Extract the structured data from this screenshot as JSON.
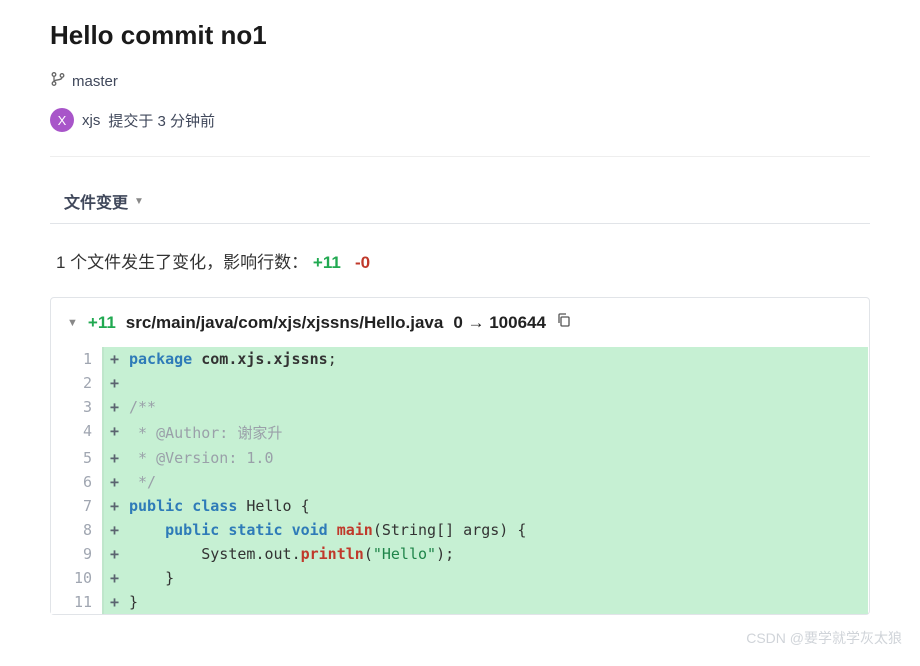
{
  "title": "Hello commit no1",
  "branch": {
    "name": "master"
  },
  "author": {
    "initial": "X",
    "name": "xjs",
    "meta": "提交于 3 分钟前"
  },
  "tabs": {
    "changes": "文件变更"
  },
  "summary": {
    "prefix": "1 个文件发生了变化，影响行数：",
    "add": "+11",
    "del": "-0"
  },
  "file": {
    "add_count": "+11",
    "path": "src/main/java/com/xjs/xjssns/Hello.java",
    "mode": "0 → 100644"
  },
  "lines": [
    {
      "n": "1",
      "tokens": [
        [
          "kw",
          "package"
        ],
        [
          "plain",
          " "
        ],
        [
          "pkg",
          "com.xjs.xjssns"
        ],
        [
          "plain",
          ";"
        ]
      ]
    },
    {
      "n": "2",
      "tokens": []
    },
    {
      "n": "3",
      "tokens": [
        [
          "cm",
          "/**"
        ]
      ]
    },
    {
      "n": "4",
      "tokens": [
        [
          "cm",
          " * @Author: 谢家升"
        ]
      ]
    },
    {
      "n": "5",
      "tokens": [
        [
          "cm",
          " * @Version: 1.0"
        ]
      ]
    },
    {
      "n": "6",
      "tokens": [
        [
          "cm",
          " */"
        ]
      ]
    },
    {
      "n": "7",
      "tokens": [
        [
          "kw",
          "public"
        ],
        [
          "plain",
          " "
        ],
        [
          "kw",
          "class"
        ],
        [
          "plain",
          " "
        ],
        [
          "cls",
          "Hello"
        ],
        [
          "plain",
          " {"
        ]
      ]
    },
    {
      "n": "8",
      "tokens": [
        [
          "plain",
          "    "
        ],
        [
          "kw",
          "public"
        ],
        [
          "plain",
          " "
        ],
        [
          "kw",
          "static"
        ],
        [
          "plain",
          " "
        ],
        [
          "kw",
          "void"
        ],
        [
          "plain",
          " "
        ],
        [
          "fn",
          "main"
        ],
        [
          "plain",
          "("
        ],
        [
          "type",
          "String"
        ],
        [
          "plain",
          "[] args) {"
        ]
      ]
    },
    {
      "n": "9",
      "tokens": [
        [
          "plain",
          "        "
        ],
        [
          "type",
          "System"
        ],
        [
          "plain",
          "."
        ],
        [
          "type",
          "out"
        ],
        [
          "plain",
          "."
        ],
        [
          "fn",
          "println"
        ],
        [
          "plain",
          "("
        ],
        [
          "str",
          "\"Hello\""
        ],
        [
          "plain",
          ");"
        ]
      ]
    },
    {
      "n": "10",
      "tokens": [
        [
          "plain",
          "    }"
        ]
      ]
    },
    {
      "n": "11",
      "tokens": [
        [
          "plain",
          "}"
        ]
      ]
    }
  ],
  "watermark": "CSDN @要学就学灰太狼"
}
